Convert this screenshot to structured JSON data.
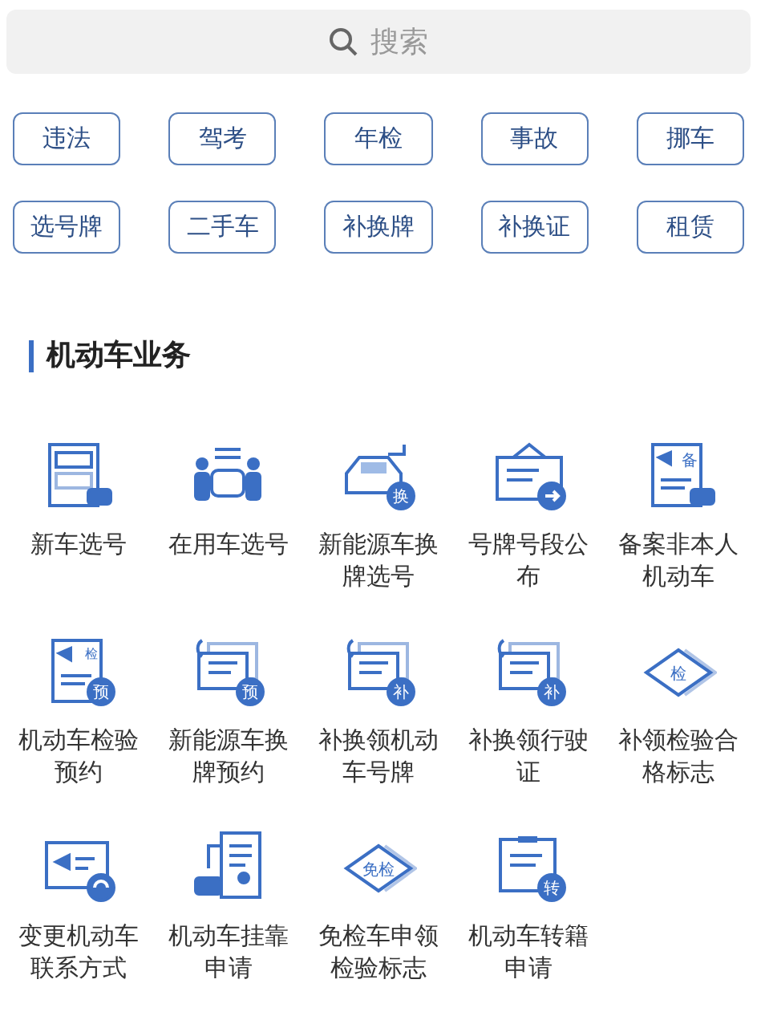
{
  "search": {
    "placeholder": "搜索"
  },
  "tags": [
    "违法",
    "驾考",
    "年检",
    "事故",
    "挪车",
    "选号牌",
    "二手车",
    "补换牌",
    "补换证",
    "租赁"
  ],
  "section": {
    "title": "机动车业务"
  },
  "services": [
    {
      "kind": "form",
      "label": "新车选号"
    },
    {
      "kind": "handover",
      "label": "在用车选号"
    },
    {
      "kind": "ev",
      "badge": "换",
      "label": "新能源车换牌选号"
    },
    {
      "kind": "notice",
      "label": "号牌号段公布"
    },
    {
      "kind": "record",
      "badge": "备",
      "label": "备案非本人机动车"
    },
    {
      "kind": "inspect",
      "badge": "预",
      "label": "机动车检验预约",
      "note": "检"
    },
    {
      "kind": "plate",
      "badge": "预",
      "label": "新能源车换牌预约"
    },
    {
      "kind": "plate",
      "badge": "补",
      "label": "补换领机动车号牌"
    },
    {
      "kind": "license",
      "badge": "补",
      "label": "补换领行驶证"
    },
    {
      "kind": "sign",
      "badge": "检",
      "label": "补领检验合格标志"
    },
    {
      "kind": "contact",
      "label": "变更机动车联系方式"
    },
    {
      "kind": "affiliate",
      "label": "机动车挂靠申请"
    },
    {
      "kind": "sign",
      "badge": "免检",
      "label": "免检车申领检验标志"
    },
    {
      "kind": "transfer",
      "badge": "转",
      "label": "机动车转籍申请"
    }
  ]
}
